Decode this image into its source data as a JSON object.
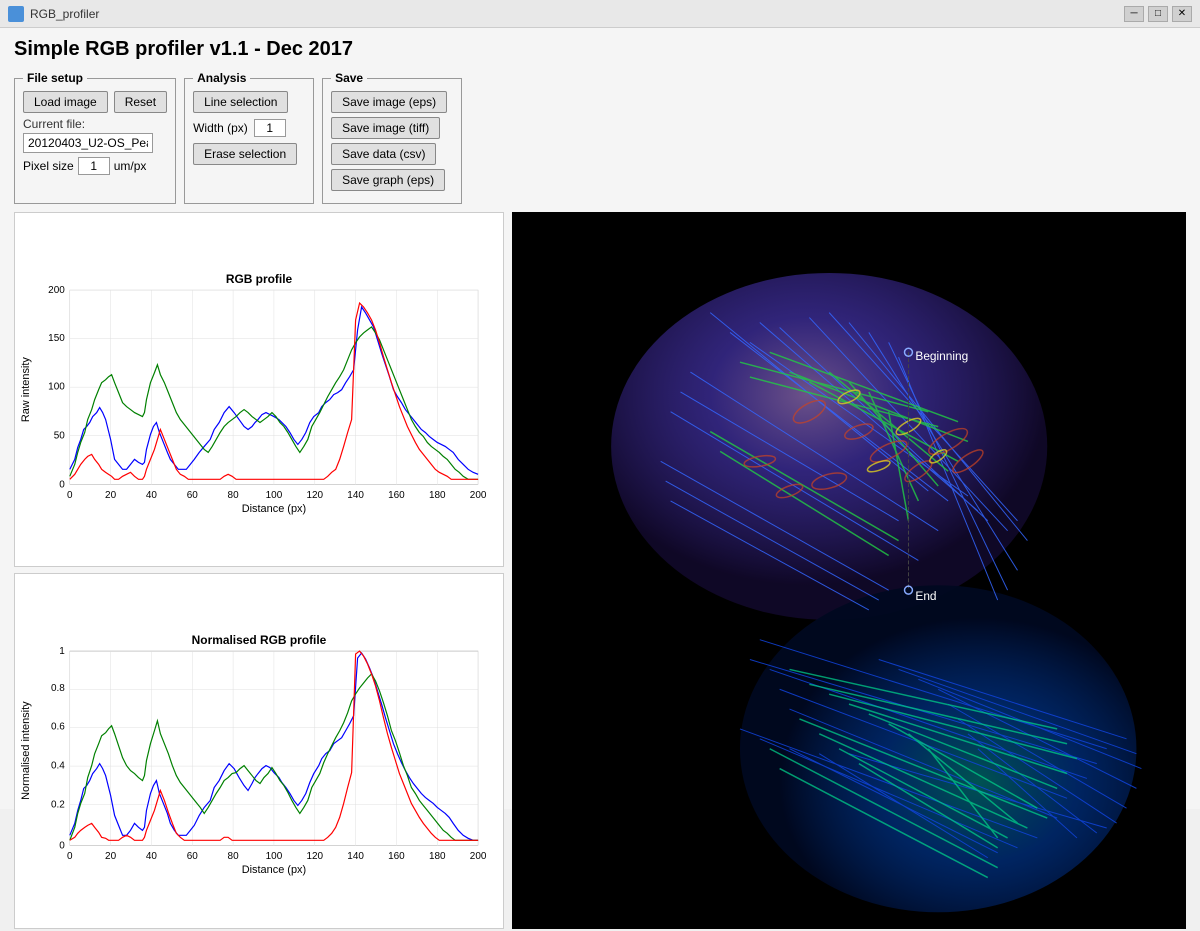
{
  "titleBar": {
    "icon": "rgb-profiler-icon",
    "title": "RGB_profiler",
    "minimize": "─",
    "maximize": "□",
    "close": "✕"
  },
  "appTitle": "Simple RGB profiler v1.1 - Dec 2017",
  "fileSetup": {
    "legend": "File setup",
    "loadButton": "Load image",
    "resetButton": "Reset",
    "currentFileLabel": "Current file:",
    "currentFileValue": "20120403_U2-OS_Pea",
    "pixelSizeLabel": "Pixel size",
    "pixelSizeValue": "1",
    "pixelSizeUnit": "um/px"
  },
  "analysis": {
    "legend": "Analysis",
    "lineSelectionButton": "Line selection",
    "widthLabel": "Width (px)",
    "widthValue": "1",
    "eraseSelectionButton": "Erase selection"
  },
  "save": {
    "legend": "Save",
    "saveImageEps": "Save image (eps)",
    "saveImageTiff": "Save image (tiff)",
    "saveDataCsv": "Save data (csv)",
    "saveGraphEps": "Save graph (eps)"
  },
  "charts": {
    "rgbProfile": {
      "title": "RGB profile",
      "yLabel": "Raw intensity",
      "xLabel": "Distance (px)",
      "yMax": 200,
      "xMax": 200,
      "yTicks": [
        0,
        50,
        100,
        150,
        200
      ],
      "xTicks": [
        0,
        20,
        40,
        60,
        80,
        100,
        120,
        140,
        160,
        180,
        200
      ]
    },
    "normalisedProfile": {
      "title": "Normalised RGB profile",
      "yLabel": "Normalised intensity",
      "xLabel": "Distance (px)",
      "yMax": 1,
      "xMax": 200,
      "yTicks": [
        0,
        0.2,
        0.4,
        0.6,
        0.8,
        1
      ],
      "xTicks": [
        0,
        20,
        40,
        60,
        80,
        100,
        120,
        140,
        160,
        180,
        200
      ]
    }
  },
  "imageAnnotations": {
    "beginning": "Beginning",
    "end": "End"
  }
}
